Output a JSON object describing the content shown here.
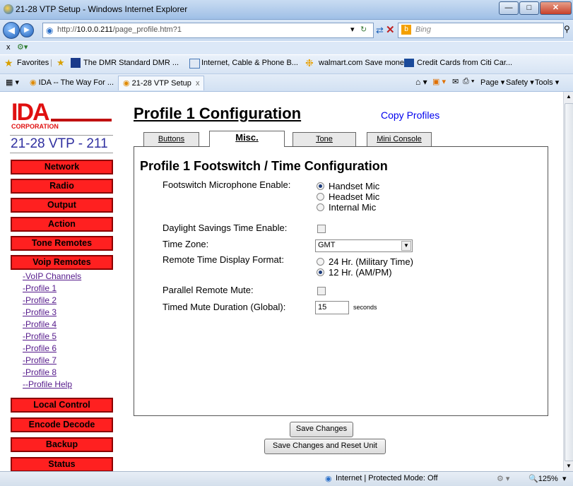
{
  "window": {
    "title": "21-28 VTP Setup - Windows Internet Explorer"
  },
  "browser": {
    "url_prefix": "http://",
    "url_host": "10.0.0.211",
    "url_path": "/page_profile.htm?1",
    "search_placeholder": "Bing",
    "menu_x": "x",
    "favorites_label": "Favorites",
    "favorites": [
      "The DMR Standard DMR ...",
      "Internet, Cable & Phone B...",
      "walmart.com Save money...",
      "Credit Cards from Citi Car..."
    ],
    "tabs": [
      "IDA -- The Way For ...",
      "21-28 VTP Setup"
    ],
    "tab_close": "x",
    "command_items": [
      "Page ▾",
      "Safety ▾",
      "Tools ▾"
    ],
    "status_zone": "Internet | Protected Mode: Off",
    "zoom": "125%"
  },
  "sidebar": {
    "logo_text": "IDA",
    "logo_sub": "CORPORATION",
    "device_name": "21-28 VTP - 211",
    "nav_top": [
      "Network",
      "Radio",
      "Output",
      "Action",
      "Tone Remotes",
      "Voip Remotes"
    ],
    "links": [
      "-VoIP Channels",
      "-Profile 1",
      "-Profile 2",
      "-Profile 3",
      "-Profile 4",
      "-Profile 5",
      "-Profile 6",
      "-Profile 7",
      "-Profile 8",
      "--Profile Help"
    ],
    "nav_bottom": [
      "Local Control",
      "Encode Decode",
      "Backup",
      "Status"
    ]
  },
  "main": {
    "title": "Profile 1 Configuration",
    "copy_link": "Copy Profiles",
    "tabs": [
      "Buttons",
      "Misc.",
      "Tone",
      "Mini Console"
    ],
    "section_title": "Profile 1 Footswitch / Time Configuration",
    "footswitch_label": "Footswitch Microphone Enable:",
    "mic_options": [
      "Handset Mic",
      "Headset Mic",
      "Internal Mic"
    ],
    "mic_selected": "Handset Mic",
    "dst_label": "Daylight Savings Time Enable:",
    "dst_checked": false,
    "timezone_label": "Time Zone:",
    "timezone_value": "GMT",
    "format_label": "Remote Time Display Format:",
    "format_options": [
      "24 Hr. (Military Time)",
      "12 Hr. (AM/PM)"
    ],
    "format_selected": "12 Hr. (AM/PM)",
    "parallel_label": "Parallel Remote Mute:",
    "parallel_checked": false,
    "timed_label": "Timed Mute Duration (Global):",
    "timed_value": "15",
    "timed_unit": "seconds",
    "save_button": "Save Changes",
    "save_reset_button": "Save Changes and Reset Unit"
  },
  "colors": {
    "nav_red": "#ff2020",
    "link_purple": "#551a8b",
    "link_blue": "#0000ee"
  }
}
